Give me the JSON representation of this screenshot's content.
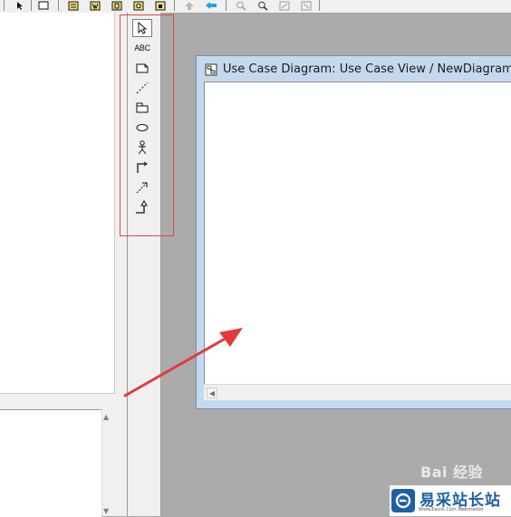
{
  "toolbar": {
    "buttons": [
      {
        "name": "toolbar-button-1",
        "icon": "vertical-bar-icon"
      },
      {
        "name": "toolbar-button-2",
        "icon": "pointer-icon"
      },
      {
        "name": "toolbar-button-3",
        "icon": "blank-box-icon"
      },
      {
        "name": "toolbar-button-4",
        "icon": "doc-icon"
      },
      {
        "name": "toolbar-button-5",
        "icon": "doc-icon"
      },
      {
        "name": "toolbar-button-6",
        "icon": "doc-icon"
      },
      {
        "name": "toolbar-button-7",
        "icon": "doc-icon"
      },
      {
        "name": "toolbar-button-8",
        "icon": "up-arrow-icon"
      },
      {
        "name": "toolbar-button-9",
        "icon": "back-arrow-icon"
      },
      {
        "name": "toolbar-button-10",
        "icon": "zoom-in-icon"
      },
      {
        "name": "toolbar-button-11",
        "icon": "zoom-out-icon"
      },
      {
        "name": "toolbar-button-12",
        "icon": "fit-window-icon"
      },
      {
        "name": "toolbar-button-13",
        "icon": "undo-fit-icon"
      }
    ]
  },
  "toolbox": {
    "tools": [
      {
        "name": "select-tool",
        "icon": "cursor-arrow-icon"
      },
      {
        "name": "text-tool",
        "icon": "text-abc-icon",
        "label": "ABC"
      },
      {
        "name": "note-tool",
        "icon": "note-icon"
      },
      {
        "name": "anchor-note-tool",
        "icon": "dashed-line-icon"
      },
      {
        "name": "package-tool",
        "icon": "package-icon"
      },
      {
        "name": "use-case-tool",
        "icon": "ellipse-icon"
      },
      {
        "name": "actor-tool",
        "icon": "actor-icon"
      },
      {
        "name": "association-tool",
        "icon": "association-icon"
      },
      {
        "name": "dependency-tool",
        "icon": "dependency-arrow-icon"
      },
      {
        "name": "generalization-tool",
        "icon": "generalization-icon"
      }
    ],
    "highlight_color": "#e24646"
  },
  "diagram_window": {
    "title": "Use Case Diagram: Use Case View / NewDiagram",
    "title_icon": "diagram-icon"
  },
  "annotation": {
    "arrow_color": "#e23a3a"
  },
  "watermark": {
    "baidu_text": "Bai 经验",
    "site_name": "易采站长站",
    "site_url": "Www.Easck.Com  Webmaster"
  },
  "colors": {
    "background": "#ababab",
    "panel": "#f0f0f0",
    "window_frame": "#c5d9ee",
    "brand_blue": "#1d5fa8"
  }
}
